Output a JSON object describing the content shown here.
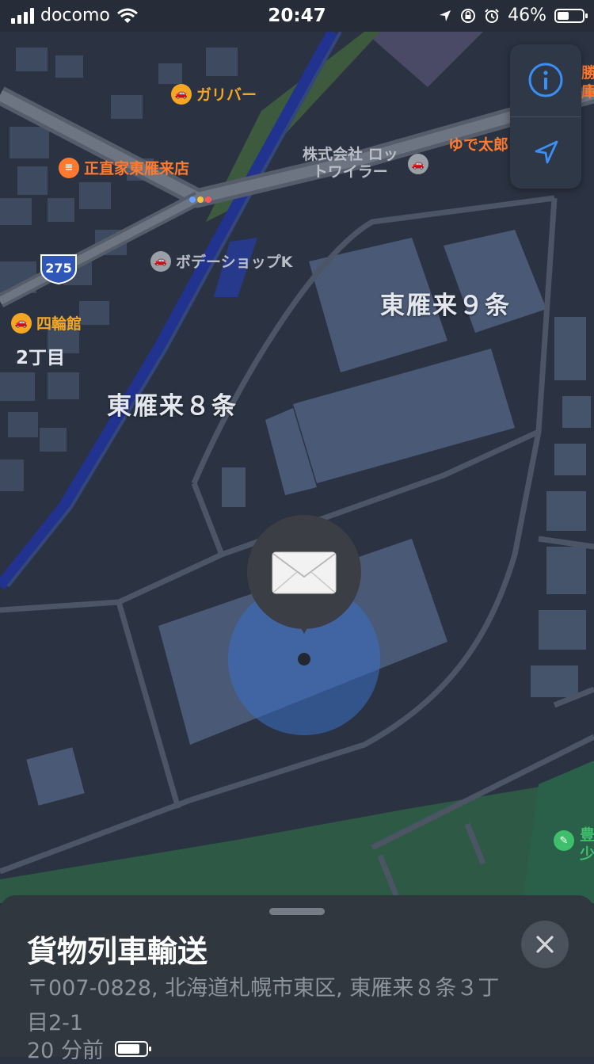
{
  "status_bar": {
    "carrier": "docomo",
    "time": "20:47",
    "battery_percent": "46%",
    "battery_level": 0.46,
    "icons": [
      "signal-bars-icon",
      "wifi-icon",
      "location-arrow-icon",
      "orientation-lock-icon",
      "alarm-clock-icon",
      "battery-icon"
    ]
  },
  "map": {
    "route_shield": "275",
    "pois": [
      {
        "name": "ガリバー",
        "icon": "car-icon",
        "color": "#f5a623"
      },
      {
        "name": "正直家東雁来店",
        "icon": "restaurant-icon",
        "color": "#ff7a2e"
      },
      {
        "name": "株式会社 ロッ",
        "name2": "トワイラー",
        "icon": "car-icon",
        "color": "#9aa0a8"
      },
      {
        "name": "ゆで太郎",
        "icon": "restaurant-icon",
        "color": "#ff7a2e"
      },
      {
        "name": "勝",
        "name2": "庫",
        "icon": "restaurant-icon",
        "color": "#ff7a2e"
      },
      {
        "name": "ボデーショップK",
        "icon": "car-icon",
        "color": "#9aa0a8"
      },
      {
        "name": "四輪館",
        "icon": "car-icon",
        "color": "#f5a623"
      },
      {
        "name": "豊",
        "name2": "少",
        "icon": "park-icon",
        "color": "#3fbf6c"
      }
    ],
    "areas": [
      "東雁来９条",
      "東雁来８条",
      "2丁目"
    ],
    "pin": {
      "icon": "envelope-icon",
      "label": ""
    }
  },
  "controls": {
    "info_icon": "info-icon",
    "locate_icon": "location-arrow-icon",
    "accent": "#3a8ef5"
  },
  "sheet": {
    "title": "貨物列車輸送",
    "address": "〒007-0828, 北海道札幌市東区, 東雁来８条３丁目2-1",
    "time_ago": "20 分前",
    "device_battery_level": 0.8,
    "close_icon": "close-icon"
  }
}
